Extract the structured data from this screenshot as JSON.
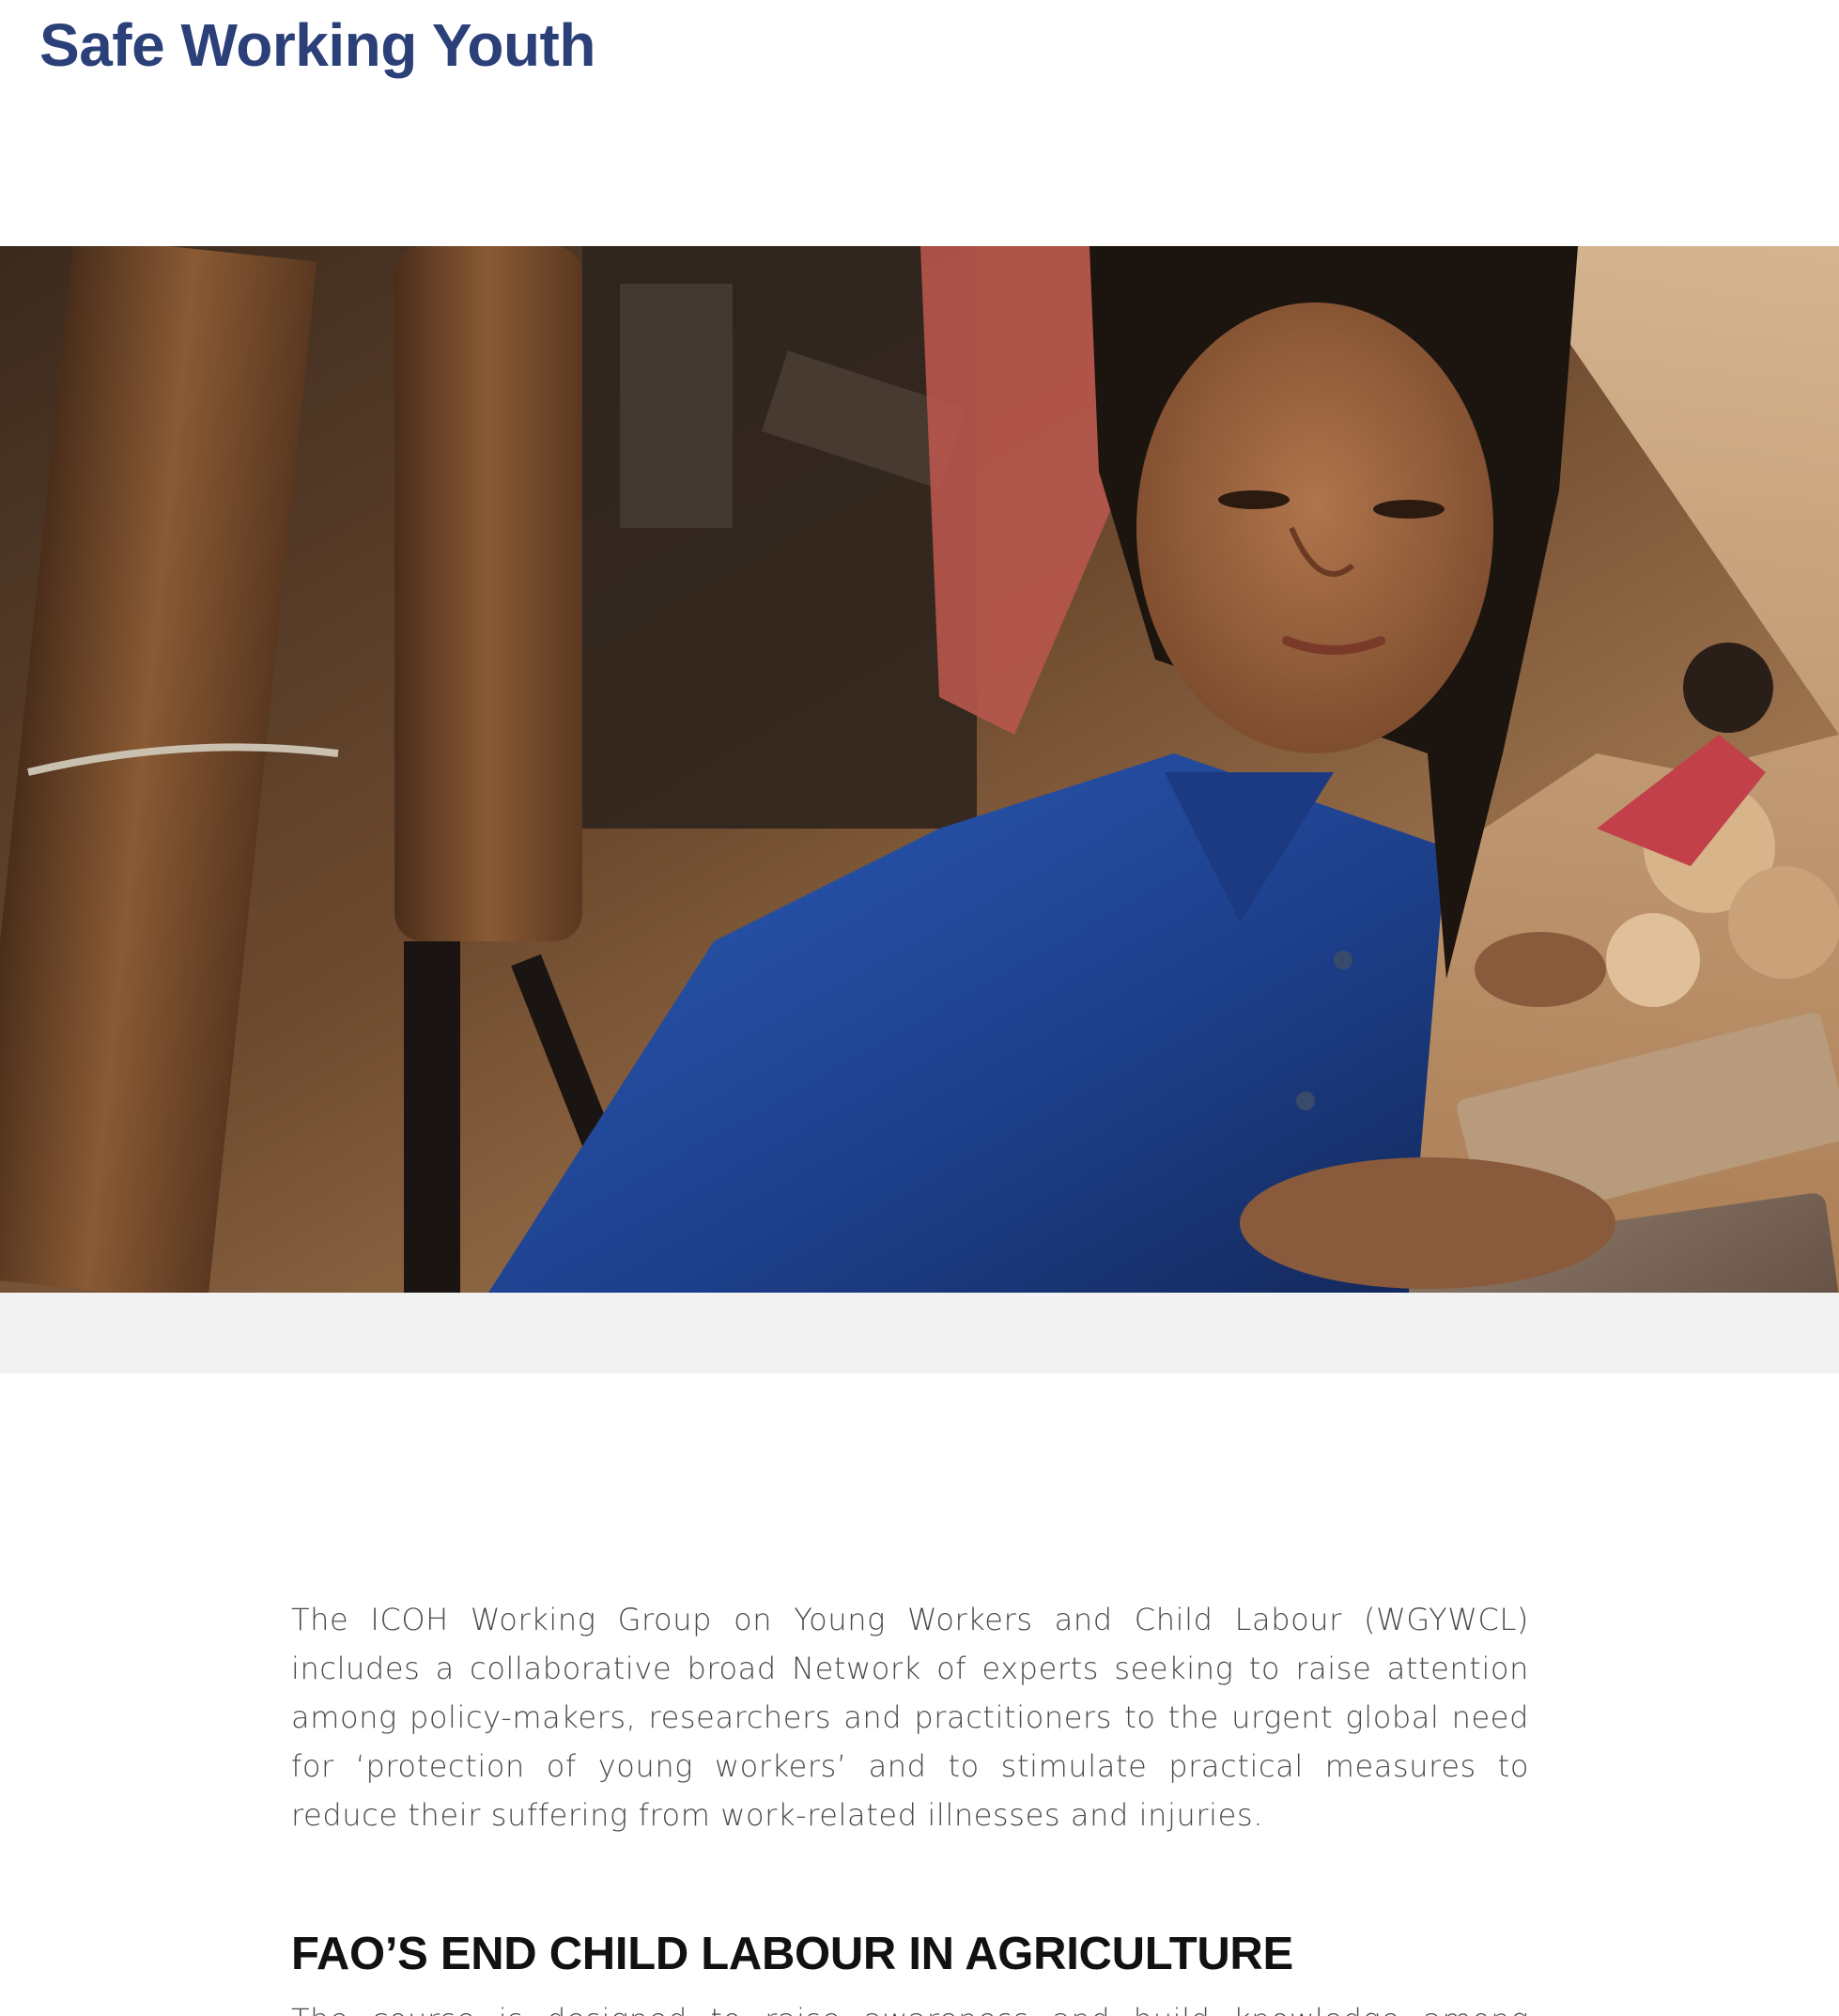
{
  "header": {
    "site_title": "Safe Working Youth"
  },
  "hero": {
    "image_subject": "girl in blue shirt carrying clay bricks at a brick kiln"
  },
  "main": {
    "intro": "The ICOH Working Group on Young Workers and Child Labour (WGYWCL) includes a collaborative broad Network of experts seeking to raise attention among policy-makers, researchers and practitioners to the urgent global need for ‘protection of young workers’ and to stimulate practical measures to reduce their suffering from work-related illnesses and injuries.",
    "sections": [
      {
        "heading": "FAO’S END CHILD LABOUR IN AGRICULTURE",
        "text": "The course is designed to raise awareness and build knowledge among agricultural"
      }
    ]
  },
  "colors": {
    "title": "#2b3f78",
    "heading": "#111111",
    "body_text": "#4a4a4a",
    "band": "#f2f2f2"
  }
}
